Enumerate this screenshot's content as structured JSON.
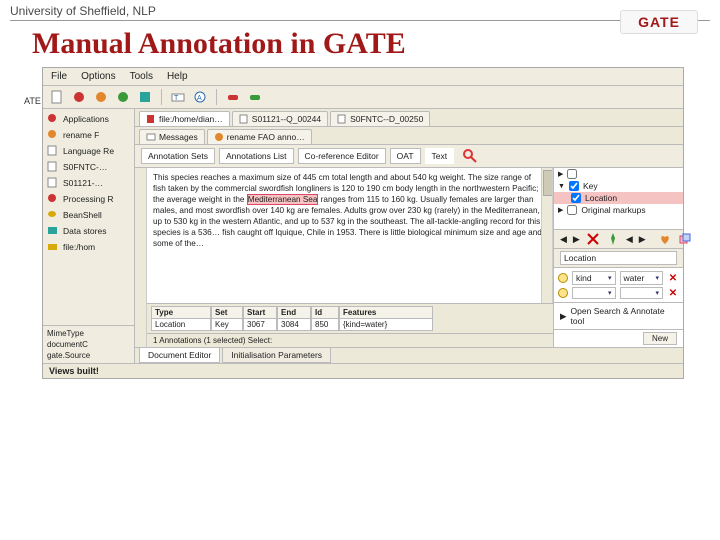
{
  "header": {
    "university": "University of Sheffield, NLP",
    "title": "Manual Annotation in GATE",
    "logo_text": "GATE"
  },
  "menu": {
    "items": [
      "File",
      "Options",
      "Tools",
      "Help"
    ]
  },
  "sidebar": {
    "title": "ATE",
    "items": [
      {
        "icon": "gear-red-icon",
        "label": "Applications"
      },
      {
        "icon": "gear-orange-icon",
        "label": "rename F"
      },
      {
        "icon": "doc-icon",
        "label": "Language Re"
      },
      {
        "icon": "page-icon",
        "label": "S0FNTC-…"
      },
      {
        "icon": "page-icon",
        "label": "S01121-…"
      },
      {
        "icon": "gear-red-icon",
        "label": "Processing R"
      },
      {
        "icon": "bean-icon",
        "label": "BeanShell"
      },
      {
        "icon": "disk-icon",
        "label": "Data stores"
      },
      {
        "icon": "folder-icon",
        "label": "file:/hom"
      }
    ],
    "meta": [
      {
        "k": "MimeType",
        "v": ""
      },
      {
        "k": "documentC",
        "v": ""
      },
      {
        "k": "gate.Source",
        "v": ""
      }
    ]
  },
  "doc_tabs_top": [
    {
      "icon": "page-red-icon",
      "label": "file:/home/dian…"
    },
    {
      "icon": "page-icon",
      "label": "S01121--Q_00244"
    },
    {
      "icon": "page-icon",
      "label": "S0FNTC--D_00250"
    }
  ],
  "doc_tabs_second": [
    {
      "icon": "msg-icon",
      "label": "Messages"
    },
    {
      "icon": "gear-orange-icon",
      "label": "rename FAO anno…"
    }
  ],
  "panel_buttons": [
    "Annotation Sets",
    "Annotations List",
    "Co-reference Editor",
    "OAT",
    "Text"
  ],
  "document_text": {
    "p1": "This species reaches a maximum size of 445 cm total length and about 540 kg weight. The size range of fish taken by the commercial swordfish longliners is 120 to 190 cm body length in the northwestern Pacific; the average weight in the ",
    "hl1": "Mediterranean Sea",
    "p2": " ranges from 115 to 160 kg. Usually females are larger than males, and most swordfish over 140 kg are females. Adults grow over 230 kg (rarely) in the Mediterranean, up to 530 kg in the western Atlantic, and up to 537 kg in the southeast. The all-tackle-angling record for this species is a 536… fish caught off Iquique, Chile in 1953. There is little biological minimum size and age and some of the…"
  },
  "annotation_sets": [
    {
      "checked": false,
      "label": "",
      "expander": "▶"
    },
    {
      "checked": true,
      "label": "Key",
      "expander": "▼"
    },
    {
      "checked": true,
      "label": "Location",
      "selected": true
    },
    {
      "checked": false,
      "label": "Original markups",
      "expander": "▶"
    }
  ],
  "ann_controls": {
    "nav_left": "◀",
    "nav_right": "▶",
    "pin_label": "pin",
    "location_field_label": "Location"
  },
  "features_table": {
    "headers": [
      "Type",
      "Set",
      "Start",
      "End",
      "Id",
      "Features"
    ],
    "row": [
      "Location",
      "Key",
      "3067",
      "3084",
      "850",
      "{kind=water}"
    ]
  },
  "feature_editor": {
    "rows": [
      {
        "key": "kind",
        "value": "water"
      },
      {
        "key": "",
        "value": ""
      }
    ]
  },
  "open_search_label": "Open Search & Annotate tool",
  "ann_selection": {
    "text": "1 Annotations (1 selected)  Select:",
    "newBtn": "New"
  },
  "bottom_tabs": [
    "Document Editor",
    "Initialisation Parameters"
  ],
  "status_text": "Views built!"
}
